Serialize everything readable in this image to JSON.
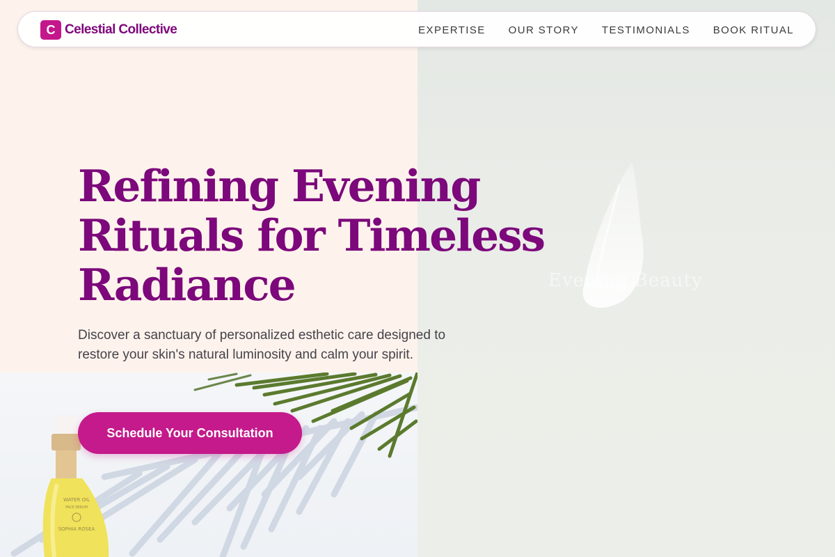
{
  "brand": {
    "logo_letter": "C",
    "name": "Celestial Collective",
    "color": "#c4178c",
    "text_color": "#7e087b"
  },
  "nav": {
    "items": [
      {
        "label": "EXPERTISE"
      },
      {
        "label": "OUR STORY"
      },
      {
        "label": "TESTIMONIALS"
      },
      {
        "label": "BOOK RITUAL"
      }
    ]
  },
  "hero": {
    "title": "Refining Evening Rituals for Timeless Radiance",
    "description": "Discover a sanctuary of personalized esthetic care designed to restore your skin's natural luminosity and calm your spirit.",
    "cta_label": "Schedule Your Consultation",
    "title_color": "#7c087b",
    "cta_color": "#c41a8b"
  },
  "imagery": {
    "watermark_text": "Evening Beauty",
    "bottle_label": [
      "WATER OIL",
      "FACE SERUM",
      "SOPHIA ROSEA"
    ]
  }
}
